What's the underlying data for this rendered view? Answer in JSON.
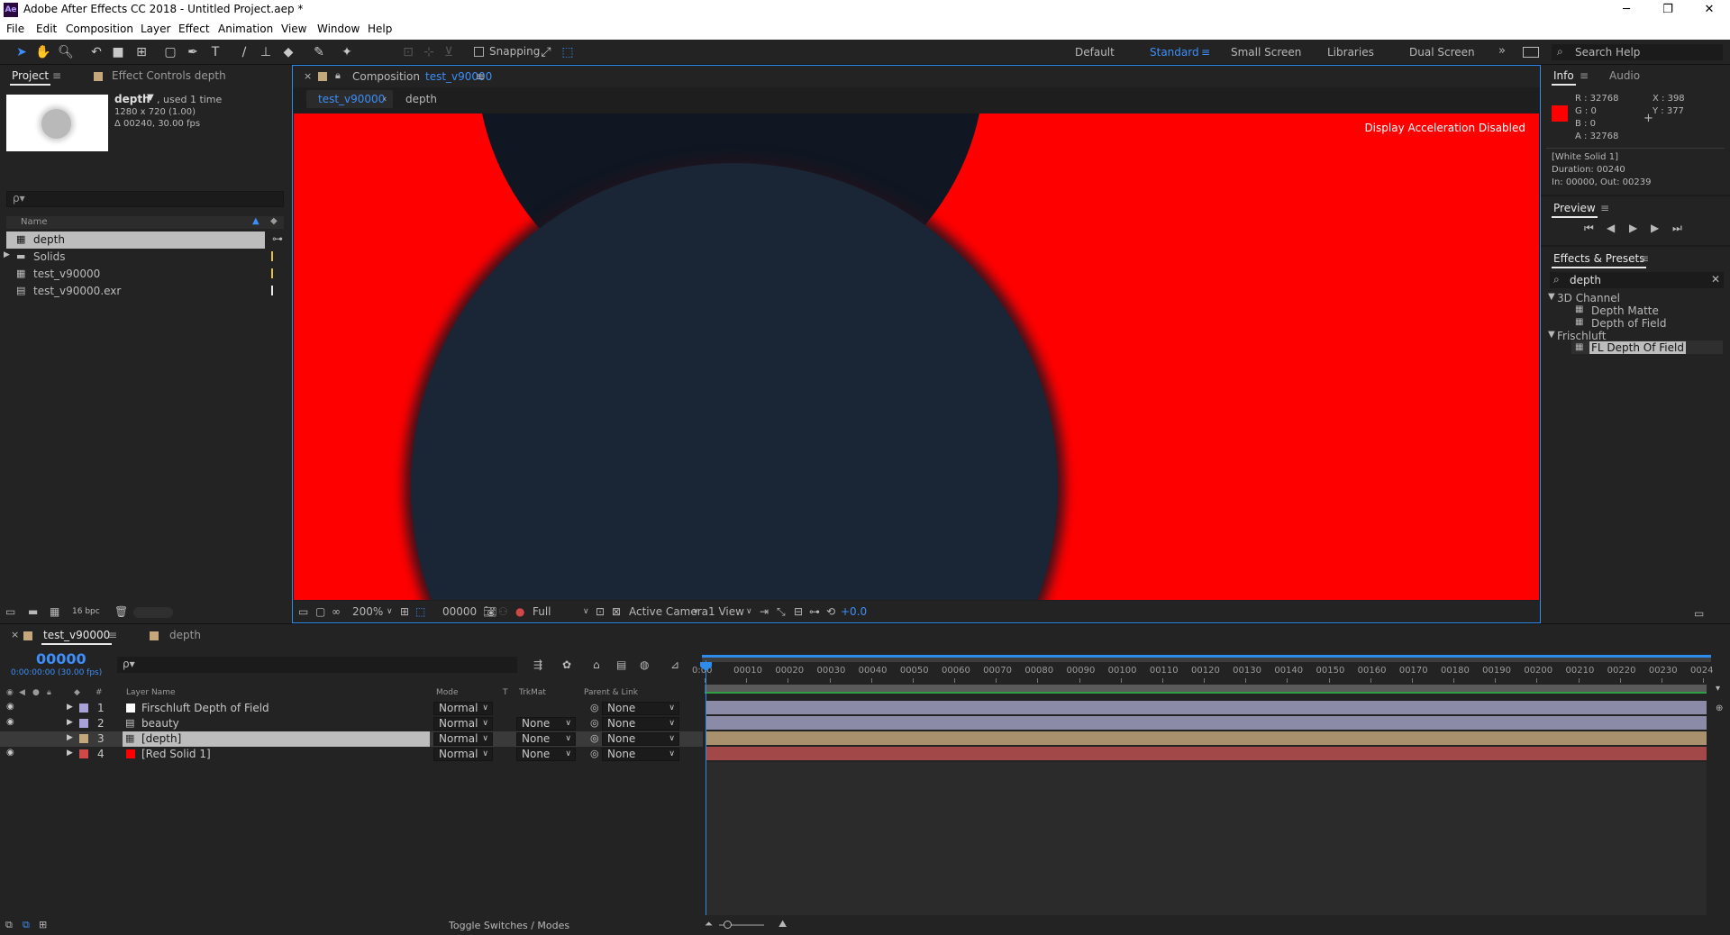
{
  "window": {
    "app_icon": "Ae",
    "title": "Adobe After Effects CC 2018 - Untitled Project.aep *",
    "min": "─",
    "restore": "❐",
    "close": "✕"
  },
  "menu": [
    "File",
    "Edit",
    "Composition",
    "Layer",
    "Effect",
    "Animation",
    "View",
    "Window",
    "Help"
  ],
  "toolbar": {
    "snapping_label": "Snapping",
    "workspaces": [
      "Default",
      "Standard",
      "Small Screen",
      "Libraries",
      "Dual Screen"
    ],
    "active_workspace": "Standard",
    "more": "»",
    "search_help": "Search Help"
  },
  "project": {
    "tab_project": "Project",
    "tab_effect_controls": "Effect Controls depth",
    "selected_name": "depth",
    "used": ", used 1 time",
    "dimensions": "1280 x 720 (1.00)",
    "duration": "Δ 00240, 30.00 fps",
    "search_placeholder": "ρ▾",
    "column_name": "Name",
    "items": [
      {
        "name": "depth",
        "type": "comp",
        "label_color": "#e0c040"
      },
      {
        "name": "Solids",
        "type": "folder",
        "label_color": "#e0c040"
      },
      {
        "name": "test_v90000",
        "type": "comp",
        "label_color": "#e0c040"
      },
      {
        "name": "test_v90000.exr",
        "type": "footage",
        "label_color": "#e8e8e8"
      }
    ],
    "bpc": "16 bpc"
  },
  "composition": {
    "tab_label": "Composition",
    "tab_comp_name": "test_v90000",
    "breadcrumb_active": "test_v90000",
    "breadcrumb_next": "depth",
    "overlay_message": "Display Acceleration Disabled",
    "zoom": "200%",
    "timecode": "00000",
    "resolution": "Full",
    "camera": "Active Camera",
    "views": "1 View",
    "exposure": "+0.0"
  },
  "info": {
    "tab_info": "Info",
    "tab_audio": "Audio",
    "swatch_color": "#ff0000",
    "r": "R :  32768",
    "g": "G :  0",
    "b": "B :  0",
    "a": "A :  32768",
    "x": "X : 398",
    "y": "Y : 377",
    "layer": "[White Solid 1]",
    "duration": "Duration: 00240",
    "inout": "In: 00000, Out: 00239"
  },
  "preview": {
    "title": "Preview"
  },
  "effects": {
    "title": "Effects & Presets",
    "search_value": "depth",
    "groups": [
      {
        "name": "3D Channel",
        "items": [
          "Depth Matte",
          "Depth of Field"
        ]
      },
      {
        "name": "Frischluft",
        "items": [
          "FL Depth Of Field"
        ]
      }
    ]
  },
  "timeline": {
    "tab_active": "test_v90000",
    "tab_other": "depth",
    "timecode": "00000",
    "timecode_sub": "0:00:00:00 (30.00 fps)",
    "search_placeholder": "ρ▾",
    "col_layer_name": "Layer Name",
    "col_mode": "Mode",
    "col_t": "T",
    "col_trkmat": "TrkMat",
    "col_parent": "Parent & Link",
    "layers": [
      {
        "num": "1",
        "name": "Firschluft Depth of Field",
        "mode": "Normal",
        "trkmat": "",
        "parent": "None",
        "label": "#a9a2d6",
        "swatch": "#ffffff",
        "bar": "#8f8faa"
      },
      {
        "num": "2",
        "name": "beauty",
        "mode": "Normal",
        "trkmat": "None",
        "parent": "None",
        "label": "#a9a2d6",
        "swatch": "#ffffff",
        "bar": "#8f8faa"
      },
      {
        "num": "3",
        "name": "[depth]",
        "mode": "Normal",
        "trkmat": "None",
        "parent": "None",
        "label": "#c4a77a",
        "swatch": "#c4a77a",
        "bar": "#a8916c"
      },
      {
        "num": "4",
        "name": "[Red Solid 1]",
        "mode": "Normal",
        "trkmat": "None",
        "parent": "None",
        "label": "#d04848",
        "swatch": "#ff0000",
        "bar": "#a34848"
      }
    ],
    "ruler": [
      "0:00",
      "00010",
      "00020",
      "00030",
      "00040",
      "00050",
      "00060",
      "00070",
      "00080",
      "00090",
      "00100",
      "00110",
      "00120",
      "00130",
      "00140",
      "00150",
      "00160",
      "00170",
      "00180",
      "00190",
      "00200",
      "00210",
      "00220",
      "00230",
      "0024"
    ],
    "toggle_label": "Toggle Switches / Modes"
  }
}
